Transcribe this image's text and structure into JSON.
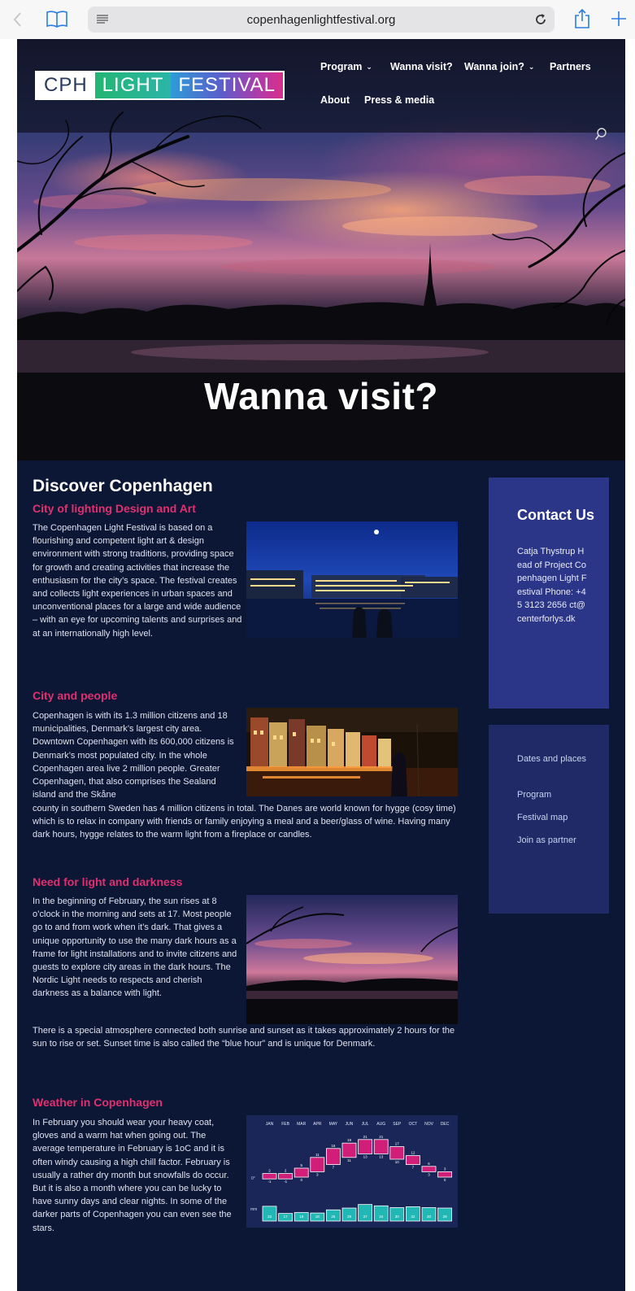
{
  "browser": {
    "url": "copenhagenlightfestival.org"
  },
  "logo": {
    "part1": "CPH",
    "part2": "LIGHT",
    "part3": "FESTIVAL"
  },
  "nav": {
    "items": [
      {
        "label": "Program",
        "has_dropdown": true
      },
      {
        "label": "Wanna visit?",
        "has_dropdown": false
      },
      {
        "label": "Wanna join?",
        "has_dropdown": true
      },
      {
        "label": "Partners",
        "has_dropdown": false
      },
      {
        "label": "About",
        "has_dropdown": false
      },
      {
        "label": "Press & media",
        "has_dropdown": false
      }
    ]
  },
  "hero": {
    "title": "Wanna visit?"
  },
  "main": {
    "heading": "Discover Copenhagen",
    "sections": [
      {
        "title": "City of lighting Design and Art",
        "text": "The Copenhagen Light Festival is based on a flourishing and competent light art & design environment with strong traditions, providing space for growth and creating activities that increase the enthusiasm for the city’s space. The festival creates and collects light experiences in urban spaces and unconventional places for a large and wide audience – with an eye for upcoming talents and surprises and at an internationally high level."
      },
      {
        "title": "City and people",
        "text_top": "Copenhagen is with its 1.3 million citizens and 18 municipalities, Denmark’s largest city area. Downtown Copenhagen with its 600,000 citizens is Denmark’s most populated city. In the whole Copenhagen area live 2 million people. Greater Copenhagen, that also comprises the Sealand island and the Skåne",
        "text_bottom": "county in southern Sweden has 4 million citizens in total. The Danes are world known for hygge (cosy time) which is to relax in company with friends or family enjoying a meal and a beer/glass of wine. Having many dark hours, hygge relates to the warm light from a fireplace or candles."
      },
      {
        "title": "Need for light and darkness",
        "text_top": "In the beginning of February, the sun rises at 8 o’clock in the morning and sets at 17. Most people go to and from work when it’s dark. That gives a unique opportunity to use the many dark hours as a frame for light installations and to invite citizens and guests to explore city areas in the dark hours. The Nordic Light needs to respects and cherish darkness as a balance with light.",
        "text_bottom": "There is a special atmosphere connected both sunrise and sunset as it takes approximately 2 hours for the sun to rise or set. Sunset time is also called the “blue hour” and is unique for Denmark."
      },
      {
        "title": "Weather in Copenhagen",
        "text": "In February you should wear your heavy coat, gloves and a warm hat when going out. The average temperature in February is 1oC and it is often windy causing a high chill factor. February is usually a rather dry month but snowfalls do occur. But it is also a month where you can be lucky to have sunny days and clear nights. In some of the darker parts of Copenhagen you can even see the stars."
      }
    ]
  },
  "sidebar": {
    "contact_title": "Contact Us",
    "contact_lines": "Catja Thystrup Head of Project Copenhagen Light Festival Phone: +45 3123 2656 ct@centerforlys.dk",
    "links": [
      "Dates and places",
      "Program",
      "Festival map",
      "Join as partner"
    ]
  },
  "weather_chart": {
    "months": [
      "JAN",
      "FEB",
      "MAR",
      "APR",
      "MAY",
      "JUN",
      "JUL",
      "AUG",
      "SEP",
      "OCT",
      "NOV",
      "DEC"
    ],
    "temp_high": [
      2,
      2,
      5,
      11,
      16,
      19,
      21,
      21,
      17,
      12,
      6,
      3
    ],
    "temp_low": [
      -1,
      -1,
      0,
      3,
      7,
      11,
      13,
      13,
      10,
      7,
      3,
      0
    ],
    "zero_label": "0°",
    "rain_label": "mm",
    "rain": [
      33,
      17,
      19,
      18,
      25,
      29,
      37,
      34,
      30,
      32,
      30,
      29
    ],
    "colors": {
      "temp": "#d01e79",
      "rain": "#20b7b4"
    }
  }
}
